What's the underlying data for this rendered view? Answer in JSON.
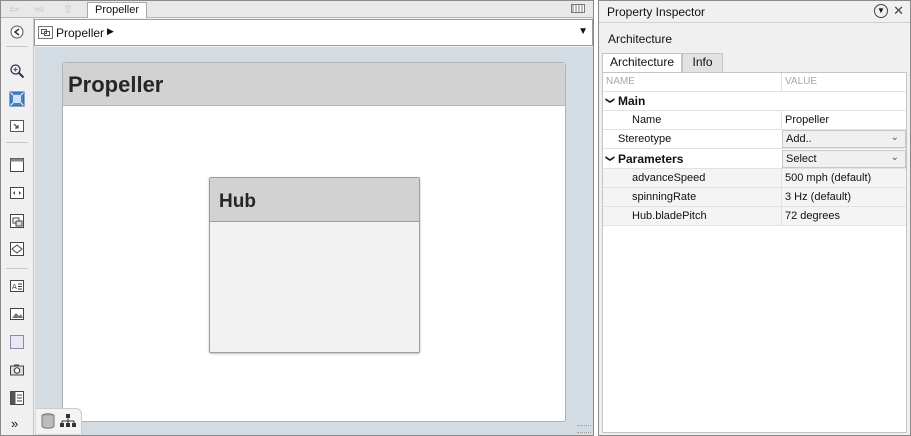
{
  "editor": {
    "tab_label": "Propeller",
    "breadcrumb": {
      "label": "Propeller"
    },
    "canvas": {
      "outer_component": "Propeller",
      "inner_component": "Hub"
    }
  },
  "inspector": {
    "title": "Property Inspector",
    "section": "Architecture",
    "tabs": [
      "Architecture",
      "Info"
    ],
    "columns": {
      "name": "NAME",
      "value": "VALUE"
    },
    "groups": {
      "main": "Main",
      "parameters": "Parameters"
    },
    "rows": {
      "name": {
        "label": "Name",
        "value": "Propeller"
      },
      "stereotype": {
        "label": "Stereotype",
        "value": "Add.."
      },
      "parameters_select": "Select",
      "advance_speed": {
        "label": "advanceSpeed",
        "value": "500 mph (default)"
      },
      "spinning_rate": {
        "label": "spinningRate",
        "value": "3 Hz (default)"
      },
      "blade_pitch": {
        "label": "Hub.bladePitch",
        "value": "72 degrees"
      }
    }
  },
  "icons": {
    "nav": [
      "back-arrow-icon",
      "forward-arrow-icon",
      "up-arrow-icon"
    ],
    "toolstrip": [
      "hide-explorer-icon",
      "zoom-icon",
      "fit-to-view-icon",
      "zoom-to-normal-icon",
      "component-icon",
      "port-icon",
      "reference-component-icon",
      "variant-component-icon",
      "annotation-icon",
      "image-icon",
      "area-icon",
      "camera-icon",
      "model-browser-icon",
      "more-tools-icon"
    ]
  },
  "colors": {
    "canvas_bg": "#d3dce3",
    "component_header": "#d2d2d2",
    "accent_blue": "#4a84c8"
  }
}
